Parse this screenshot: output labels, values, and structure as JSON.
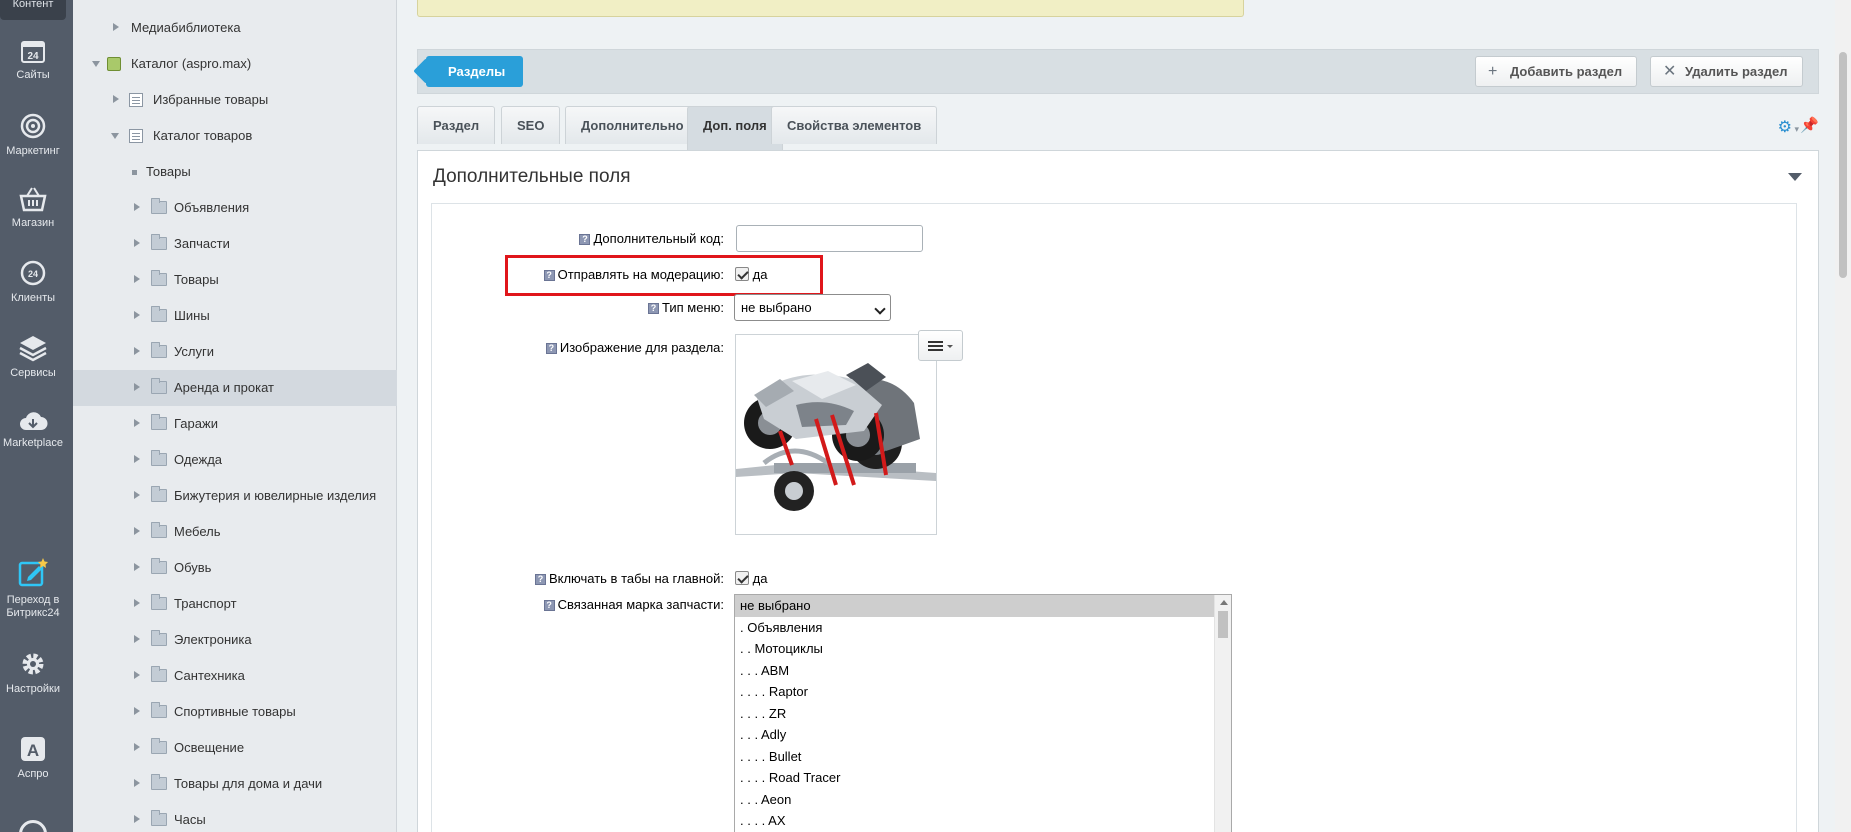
{
  "rail": {
    "top_label": "Контент",
    "items": [
      {
        "label": "Сайты",
        "icon": "calendar-24-icon"
      },
      {
        "label": "Маркетинг",
        "icon": "target-icon"
      },
      {
        "label": "Магазин",
        "icon": "basket-icon"
      },
      {
        "label": "Клиенты",
        "icon": "clients-24-icon"
      },
      {
        "label": "Сервисы",
        "icon": "layers-icon"
      },
      {
        "label": "Marketplace",
        "icon": "cloud-download-icon"
      },
      {
        "label": "Переход в Битрикс24",
        "icon": "edit-star-icon"
      },
      {
        "label": "Настройки",
        "icon": "gear-icon"
      },
      {
        "label": "Аспро",
        "icon": "letter-a-icon"
      }
    ]
  },
  "tree": {
    "items": [
      {
        "label": "Медиабиблиотека",
        "level": 1,
        "icon": "none",
        "expanded": false
      },
      {
        "label": "Каталог (aspro.max)",
        "level": 0,
        "icon": "green",
        "expanded": true
      },
      {
        "label": "Избранные товары",
        "level": 1,
        "icon": "list",
        "expanded": false
      },
      {
        "label": "Каталог товаров",
        "level": 1,
        "icon": "list",
        "expanded": true
      },
      {
        "label": "Товары",
        "level": 2,
        "icon": "dot",
        "expanded": false
      },
      {
        "label": "Объявления",
        "level": 2,
        "icon": "folder",
        "expanded": false
      },
      {
        "label": "Запчасти",
        "level": 2,
        "icon": "folder",
        "expanded": false
      },
      {
        "label": "Товары",
        "level": 2,
        "icon": "folder",
        "expanded": false
      },
      {
        "label": "Шины",
        "level": 2,
        "icon": "folder",
        "expanded": false
      },
      {
        "label": "Услуги",
        "level": 2,
        "icon": "folder",
        "expanded": false
      },
      {
        "label": "Аренда и прокат",
        "level": 2,
        "icon": "folder",
        "expanded": false,
        "active": true
      },
      {
        "label": "Гаражи",
        "level": 2,
        "icon": "folder",
        "expanded": false
      },
      {
        "label": "Одежда",
        "level": 2,
        "icon": "folder",
        "expanded": false
      },
      {
        "label": "Бижутерия и ювелирные изделия",
        "level": 2,
        "icon": "folder",
        "expanded": false
      },
      {
        "label": "Мебель",
        "level": 2,
        "icon": "folder",
        "expanded": false
      },
      {
        "label": "Обувь",
        "level": 2,
        "icon": "folder",
        "expanded": false
      },
      {
        "label": "Транспорт",
        "level": 2,
        "icon": "folder",
        "expanded": false
      },
      {
        "label": "Электроника",
        "level": 2,
        "icon": "folder",
        "expanded": false
      },
      {
        "label": "Сантехника",
        "level": 2,
        "icon": "folder",
        "expanded": false
      },
      {
        "label": "Спортивные товары",
        "level": 2,
        "icon": "folder",
        "expanded": false
      },
      {
        "label": "Освещение",
        "level": 2,
        "icon": "folder",
        "expanded": false
      },
      {
        "label": "Товары для дома и дачи",
        "level": 2,
        "icon": "folder",
        "expanded": false
      },
      {
        "label": "Часы",
        "level": 2,
        "icon": "folder",
        "expanded": false
      }
    ]
  },
  "toolbar": {
    "sections_label": "Разделы",
    "add_label": "Добавить раздел",
    "delete_label": "Удалить раздел"
  },
  "tabs": [
    "Раздел",
    "SEO",
    "Дополнительно",
    "Доп. поля",
    "Свойства элементов"
  ],
  "active_tab": "Доп. поля",
  "panel": {
    "title": "Дополнительные поля",
    "fields": {
      "extra_code_label": "Дополнительный код:",
      "extra_code_value": "",
      "moderation_label": "Отправлять на модерацию:",
      "moderation_checked": true,
      "moderation_text": "да",
      "menu_type_label": "Тип меню:",
      "menu_type_value": "не выбрано",
      "image_label": "Изображение для раздела:",
      "tabs_main_label": "Включать в табы на главной:",
      "tabs_main_checked": true,
      "tabs_main_text": "да",
      "brand_label": "Связанная марка запчасти:",
      "brand_options": [
        "не выбрано",
        ". Объявления",
        ". . Мотоциклы",
        ". . . ABM",
        ". . . . Raptor",
        ". . . . ZR",
        ". . . Adly",
        ". . . . Bullet",
        ". . . . Road Tracer",
        ". . . Aeon",
        ". . . . AX"
      ],
      "brand_selected": "не выбрано"
    }
  },
  "colors": {
    "rail_bg": "#535c69",
    "accent_blue": "#2a9fd9",
    "highlight_red": "#e0161b"
  }
}
